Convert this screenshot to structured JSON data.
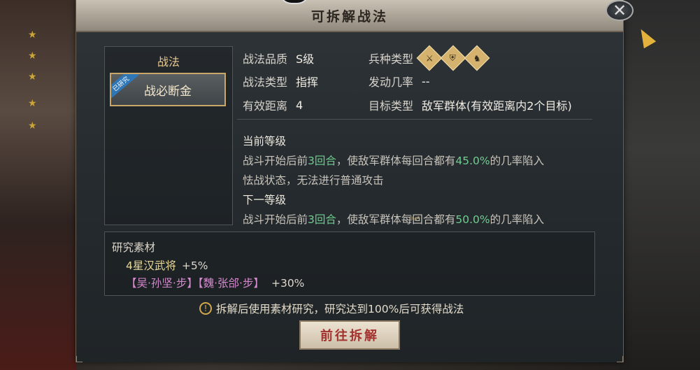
{
  "dialog": {
    "title": "可拆解战法",
    "close_icon": "close-x-icon"
  },
  "left": {
    "header": "战法",
    "tactic_name": "战必断金",
    "badge": "已研究"
  },
  "details": {
    "quality_label": "战法品质",
    "quality_value": "S级",
    "type_label": "战法类型",
    "type_value": "指挥",
    "range_label": "有效距离",
    "range_value": "4",
    "unit_type_label": "兵种类型",
    "unit_icons": [
      "cavalry-icon",
      "shield-icon",
      "horse-icon"
    ],
    "rate_label": "发动几率",
    "rate_value": "--",
    "target_label": "目标类型",
    "target_value": "敌军群体(有效距离内2个目标)"
  },
  "description": {
    "current_heading": "当前等级",
    "current_part1": "战斗开始后前",
    "current_rounds": "3回合",
    "current_part2": "，使敌军群体每回合都有",
    "current_rate": "45.0%",
    "current_part3": "的几率陷入",
    "current_line2": "怯战状态，无法进行普通攻击",
    "next_heading": "下一等级",
    "next_part1": "战斗开始后前",
    "next_rounds": "3回合",
    "next_part2": "，使敌军群体每回合都有",
    "next_rate": "50.0%",
    "next_part3": "的几率陷入"
  },
  "material": {
    "title": "研究素材",
    "line1_item": "4星汉武将",
    "line1_bonus": "+5%",
    "line2_item1": "【吴·孙坚·步】",
    "line2_item2": "【魏·张郃·步】",
    "line2_bonus": "+30%"
  },
  "note": "拆解后使用素材研究，研究达到100%后可获得战法",
  "action_button": "前往拆解"
}
